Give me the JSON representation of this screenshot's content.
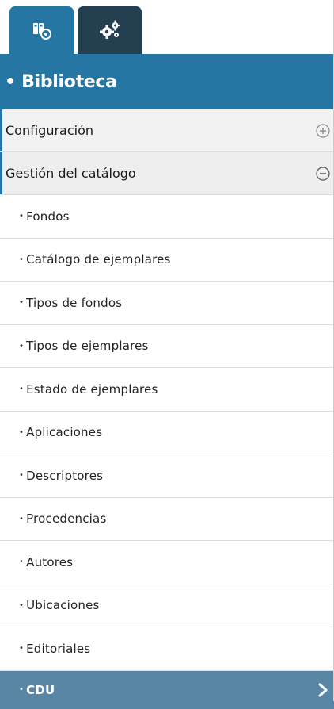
{
  "tabs": [
    {
      "icon": "catalog-books-icon",
      "active": true
    },
    {
      "icon": "gears-icon",
      "active": false
    }
  ],
  "header": {
    "title": "• Biblioteca"
  },
  "sections": [
    {
      "label": "Configuración",
      "state": "collapsed"
    },
    {
      "label": "Gestión del catálogo",
      "state": "expanded"
    }
  ],
  "items": [
    {
      "label": "Fondos"
    },
    {
      "label": "Catálogo de ejemplares"
    },
    {
      "label": "Tipos de fondos"
    },
    {
      "label": "Tipos de ejemplares"
    },
    {
      "label": "Estado de ejemplares"
    },
    {
      "label": "Aplicaciones"
    },
    {
      "label": "Descriptores"
    },
    {
      "label": "Procedencias"
    },
    {
      "label": "Autores"
    },
    {
      "label": "Ubicaciones"
    },
    {
      "label": "Editoriales"
    },
    {
      "label": "CDU",
      "selected": true
    }
  ],
  "colors": {
    "primary": "#2676a4",
    "tab_inactive": "#243f4f",
    "selected_row": "#5a86a6"
  }
}
